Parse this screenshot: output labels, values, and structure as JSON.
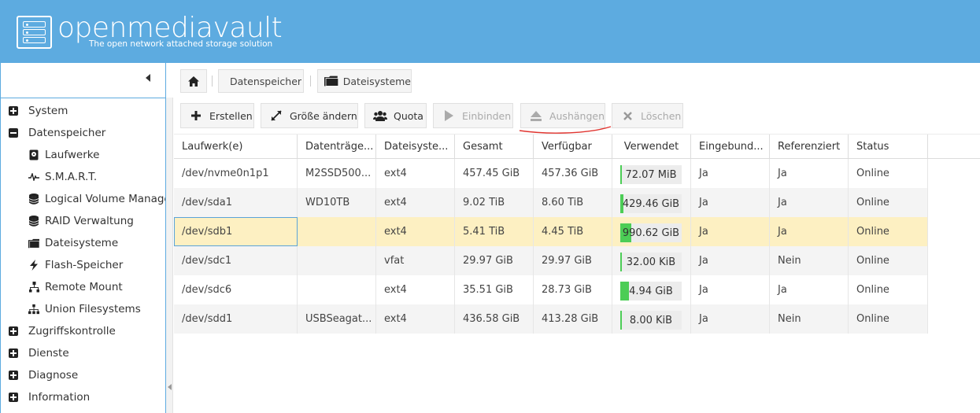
{
  "header": {
    "brand": "openmediavault",
    "tagline": "The open network attached storage solution"
  },
  "colors": {
    "header_bg": "#5dabe0",
    "usage_fill": "#4ccd56",
    "selected_row": "#fdf0c2"
  },
  "sidebar": {
    "items": [
      {
        "label": "System",
        "type": "group",
        "expanded": false
      },
      {
        "label": "Datenspeicher",
        "type": "group",
        "expanded": true
      },
      {
        "label": "Laufwerke",
        "type": "child",
        "icon": "disk-icon"
      },
      {
        "label": "S.M.A.R.T.",
        "type": "child",
        "icon": "pulse-icon"
      },
      {
        "label": "Logical Volume Management",
        "type": "child",
        "icon": "database-icon"
      },
      {
        "label": "RAID Verwaltung",
        "type": "child",
        "icon": "database-icon"
      },
      {
        "label": "Dateisysteme",
        "type": "child",
        "icon": "folder-icon"
      },
      {
        "label": "Flash-Speicher",
        "type": "child",
        "icon": "bolt-icon"
      },
      {
        "label": "Remote Mount",
        "type": "child",
        "icon": "network-icon"
      },
      {
        "label": "Union Filesystems",
        "type": "child",
        "icon": "tree-icon"
      },
      {
        "label": "Zugriffskontrolle",
        "type": "group",
        "expanded": false
      },
      {
        "label": "Dienste",
        "type": "group",
        "expanded": false
      },
      {
        "label": "Diagnose",
        "type": "group",
        "expanded": false
      },
      {
        "label": "Information",
        "type": "group",
        "expanded": false
      }
    ]
  },
  "breadcrumb": {
    "level1": "Datenspeicher",
    "level2": "Dateisysteme"
  },
  "toolbar": {
    "create": "Erstellen",
    "resize": "Größe ändern",
    "quota": "Quota",
    "mount": "Einbinden",
    "unmount": "Aushängen",
    "delete": "Löschen"
  },
  "grid": {
    "columns": [
      "Laufwerk(e)",
      "Datenträge...",
      "Dateisyste...",
      "Gesamt",
      "Verfügbar",
      "Verwendet",
      "Eingebund...",
      "Referenziert",
      "Status"
    ],
    "rows": [
      {
        "device": "/dev/nvme0n1p1",
        "label": "M2SSD500...",
        "fs": "ext4",
        "total": "457.45 GiB",
        "available": "457.36 GiB",
        "used": "72.07 MiB",
        "used_fraction": 0.01,
        "mounted": "Ja",
        "referenced": "Ja",
        "status": "Online"
      },
      {
        "device": "/dev/sda1",
        "label": "WD10TB",
        "fs": "ext4",
        "total": "9.02 TiB",
        "available": "8.60 TiB",
        "used": "429.46 GiB",
        "used_fraction": 0.05,
        "mounted": "Ja",
        "referenced": "Ja",
        "status": "Online"
      },
      {
        "device": "/dev/sdb1",
        "label": "",
        "fs": "ext4",
        "total": "5.41 TiB",
        "available": "4.45 TiB",
        "used": "990.62 GiB",
        "used_fraction": 0.18,
        "mounted": "Ja",
        "referenced": "Ja",
        "status": "Online"
      },
      {
        "device": "/dev/sdc1",
        "label": "",
        "fs": "vfat",
        "total": "29.97 GiB",
        "available": "29.97 GiB",
        "used": "32.00 KiB",
        "used_fraction": 0.0,
        "mounted": "Ja",
        "referenced": "Nein",
        "status": "Online"
      },
      {
        "device": "/dev/sdc6",
        "label": "",
        "fs": "ext4",
        "total": "35.51 GiB",
        "available": "28.73 GiB",
        "used": "4.94 GiB",
        "used_fraction": 0.14,
        "mounted": "Ja",
        "referenced": "Ja",
        "status": "Online"
      },
      {
        "device": "/dev/sdd1",
        "label": "USBSeagat...",
        "fs": "ext4",
        "total": "436.58 GiB",
        "available": "413.28 GiB",
        "used": "8.00 KiB",
        "used_fraction": 0.0,
        "mounted": "Ja",
        "referenced": "Nein",
        "status": "Online"
      }
    ]
  }
}
